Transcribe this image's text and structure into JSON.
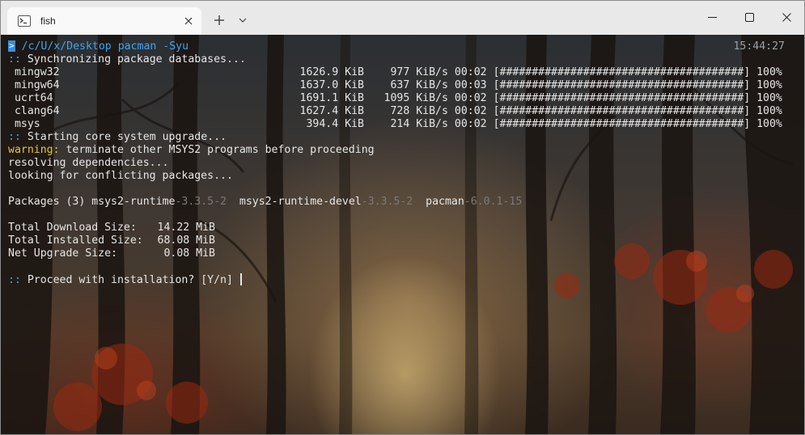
{
  "window": {
    "tab_title": "fish",
    "icons": {
      "tab": "terminal-icon",
      "tab_close": "close-icon",
      "new_tab": "plus-icon",
      "dropdown": "chevron-down-icon",
      "minimize": "minimize-icon",
      "maximize": "maximize-icon",
      "close": "close-icon"
    }
  },
  "colors": {
    "prompt_path": "#3ea5f0",
    "section_marker": "#3ea5f0",
    "warning": "#e8c53a",
    "text": "#e6e6e6"
  },
  "terminal": {
    "prompt": {
      "badge": ">",
      "path": "/c/U/x/Desktop",
      "command": "pacman",
      "args": "-Syu",
      "time": "15:44:27"
    },
    "sync_header": ":: Synchronizing package databases...",
    "sync_header_marker": "::",
    "sync_header_text": "Synchronizing package databases...",
    "databases": [
      {
        "name": "mingw32",
        "size": "1626.9 KiB",
        "speed": "977 KiB/s",
        "time": "00:02",
        "bar": "[######################################]",
        "percent": "100%"
      },
      {
        "name": "mingw64",
        "size": "1637.0 KiB",
        "speed": "637 KiB/s",
        "time": "00:03",
        "bar": "[######################################]",
        "percent": "100%"
      },
      {
        "name": "ucrt64",
        "size": "1691.1 KiB",
        "speed": "1095 KiB/s",
        "time": "00:02",
        "bar": "[######################################]",
        "percent": "100%"
      },
      {
        "name": "clang64",
        "size": "1627.4 KiB",
        "speed": "728 KiB/s",
        "time": "00:02",
        "bar": "[######################################]",
        "percent": "100%"
      },
      {
        "name": "msys",
        "size": "394.4 KiB",
        "speed": "214 KiB/s",
        "time": "00:02",
        "bar": "[######################################]",
        "percent": "100%"
      }
    ],
    "upgrade_marker": "::",
    "upgrade_text": "Starting core system upgrade...",
    "warning_label": "warning:",
    "warning_text": " terminate other MSYS2 programs before proceeding",
    "resolving": "resolving dependencies...",
    "conflicts": "looking for conflicting packages...",
    "packages_label": "Packages (3)",
    "packages": [
      {
        "name": "msys2-runtime",
        "version": "-3.3.5-2"
      },
      {
        "name": "msys2-runtime-devel",
        "version": "-3.3.5-2"
      },
      {
        "name": "pacman",
        "version": "-6.0.1-15"
      }
    ],
    "totals": [
      {
        "label": "Total Download Size:",
        "value": "14.22 MiB"
      },
      {
        "label": "Total Installed Size:",
        "value": "68.08 MiB"
      },
      {
        "label": "Net Upgrade Size:",
        "value": "0.08 MiB"
      }
    ],
    "question_marker": "::",
    "question_text": "Proceed with installation? [Y/n]"
  }
}
